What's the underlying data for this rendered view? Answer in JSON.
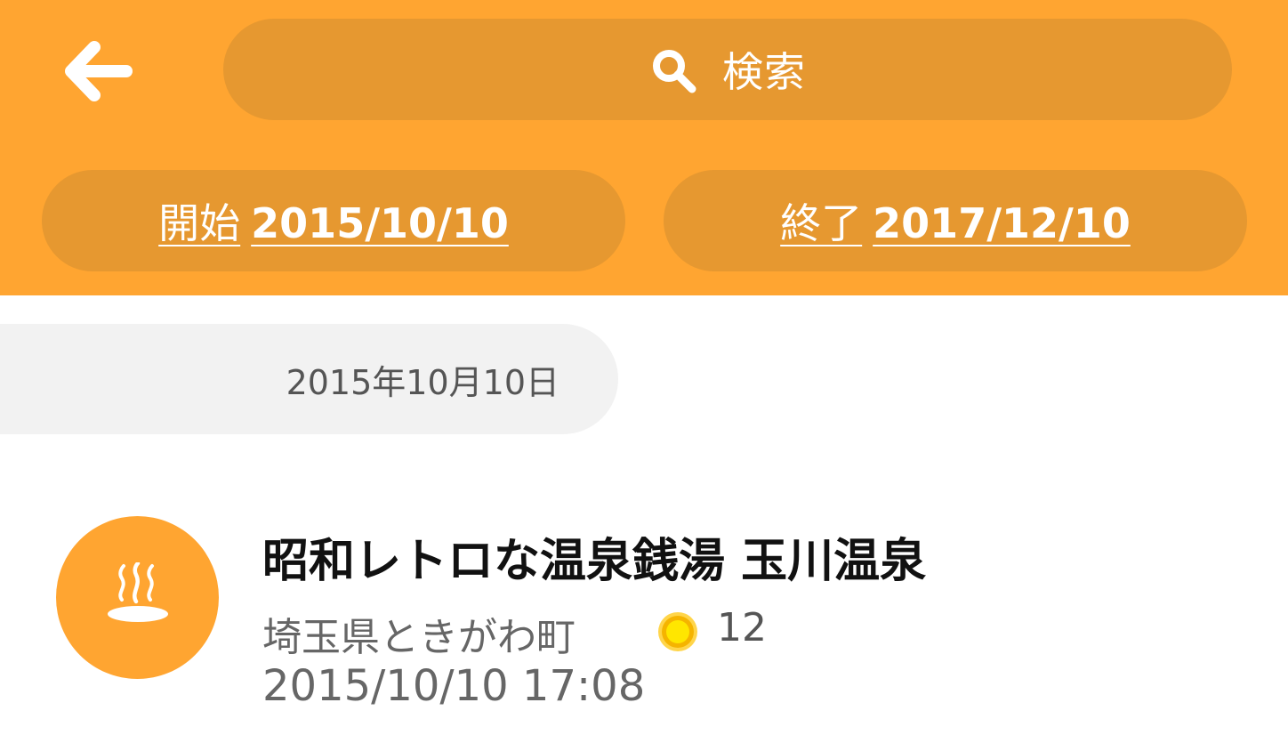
{
  "header": {
    "back_icon": "arrow-left-icon",
    "search": {
      "icon": "search-icon",
      "label": "検索"
    },
    "start": {
      "label": "開始",
      "date": "2015/10/10"
    },
    "end": {
      "label": "終了",
      "date": "2017/12/10"
    },
    "accent_color": "#FFA531"
  },
  "list": {
    "section_date": "2015年10月10日",
    "items": [
      {
        "icon": "hot-spring-icon",
        "title": "昭和レトロな温泉銭湯 玉川温泉",
        "location": "埼玉県ときがわ町",
        "coin_icon": "coin-icon",
        "count": "12",
        "datetime": "2015/10/10 17:08"
      }
    ]
  }
}
